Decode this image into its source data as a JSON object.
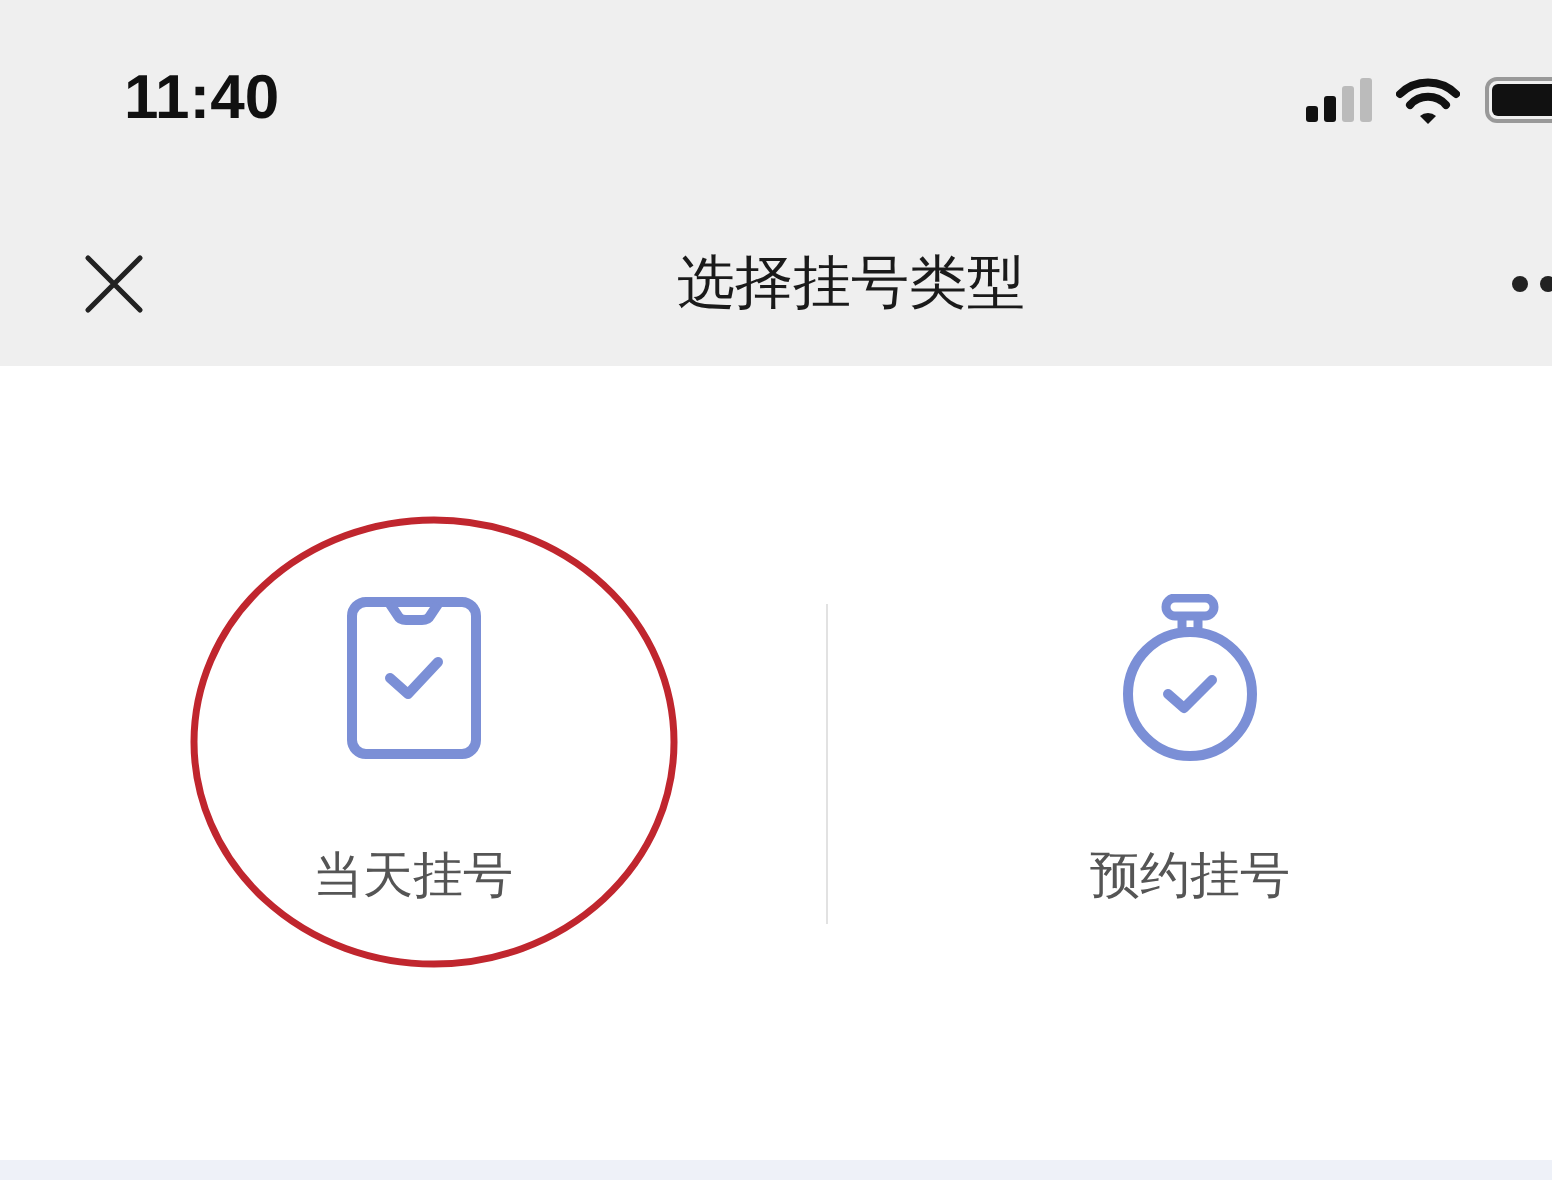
{
  "status_bar": {
    "time": "11:40"
  },
  "nav_bar": {
    "title": "选择挂号类型"
  },
  "options": [
    {
      "kind": "clipboard",
      "label": "当天挂号",
      "highlighted": true
    },
    {
      "kind": "stopwatch",
      "label": "预约挂号",
      "highlighted": false
    }
  ]
}
